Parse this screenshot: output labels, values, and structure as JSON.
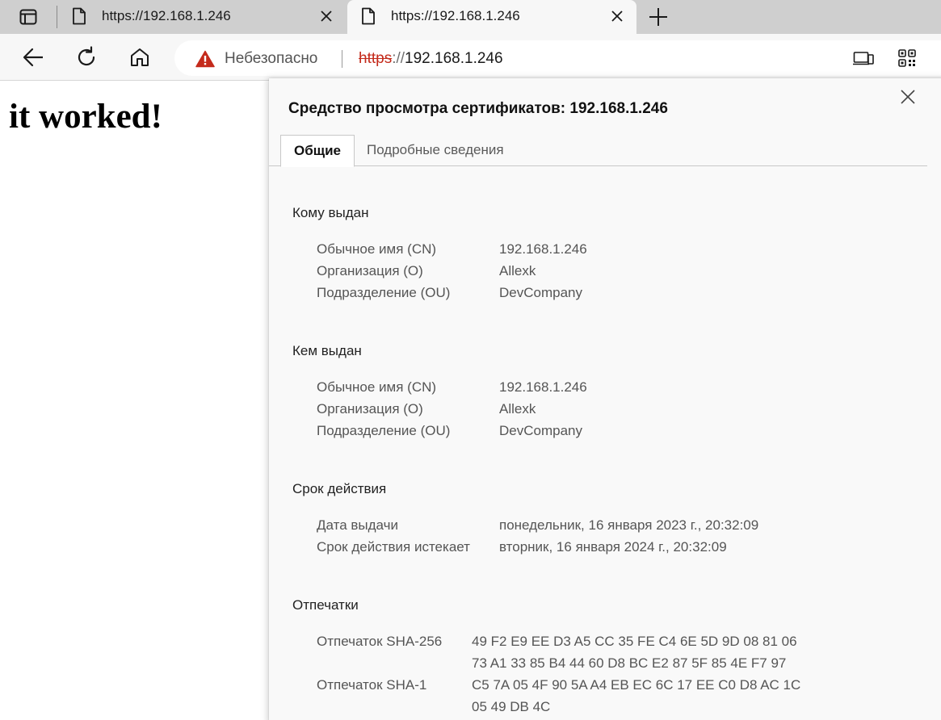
{
  "browser": {
    "tabs": [
      {
        "title": "https://192.168.1.246",
        "active": false
      },
      {
        "title": "https://192.168.1.246",
        "active": true
      }
    ],
    "omnibox": {
      "security_label": "Небезопасно",
      "url_scheme": "https",
      "url_separator": "://",
      "url_host": "192.168.1.246"
    },
    "colors": {
      "warning": "#c42b1c",
      "tabstrip": "#cfcfcf",
      "toolbar": "#f7f7f7"
    }
  },
  "page": {
    "heading": "it worked!"
  },
  "certificate_viewer": {
    "title": "Средство просмотра сертификатов: 192.168.1.246",
    "tabs": [
      {
        "label": "Общие",
        "selected": true
      },
      {
        "label": "Подробные сведения",
        "selected": false
      }
    ],
    "issued_to": {
      "title": "Кому выдан",
      "fields": [
        {
          "label": "Обычное имя (CN)",
          "value": "192.168.1.246"
        },
        {
          "label": "Организация (O)",
          "value": "Allexk"
        },
        {
          "label": "Подразделение (OU)",
          "value": "DevCompany"
        }
      ]
    },
    "issued_by": {
      "title": "Кем выдан",
      "fields": [
        {
          "label": "Обычное имя (CN)",
          "value": "192.168.1.246"
        },
        {
          "label": "Организация (O)",
          "value": "Allexk"
        },
        {
          "label": "Подразделение (OU)",
          "value": "DevCompany"
        }
      ]
    },
    "validity": {
      "title": "Срок действия",
      "fields": [
        {
          "label": "Дата выдачи",
          "value": "понедельник, 16 января 2023 г., 20:32:09"
        },
        {
          "label": "Срок действия истекает",
          "value": "вторник, 16 января 2024 г., 20:32:09"
        }
      ]
    },
    "fingerprints": {
      "title": "Отпечатки",
      "fields": [
        {
          "label": "Отпечаток SHA-256",
          "line1": "49 F2 E9 EE D3 A5 CC 35 FE C4 6E 5D 9D 08 81 06",
          "line2": "73 A1 33 85 B4 44 60 D8 BC E2 87 5F 85 4E F7 97"
        },
        {
          "label": "Отпечаток SHA-1",
          "line1": "C5 7A 05 4F 90 5A A4 EB EC 6C 17 EE C0 D8 AC 1C",
          "line2": "05 49 DB 4C"
        }
      ]
    }
  }
}
